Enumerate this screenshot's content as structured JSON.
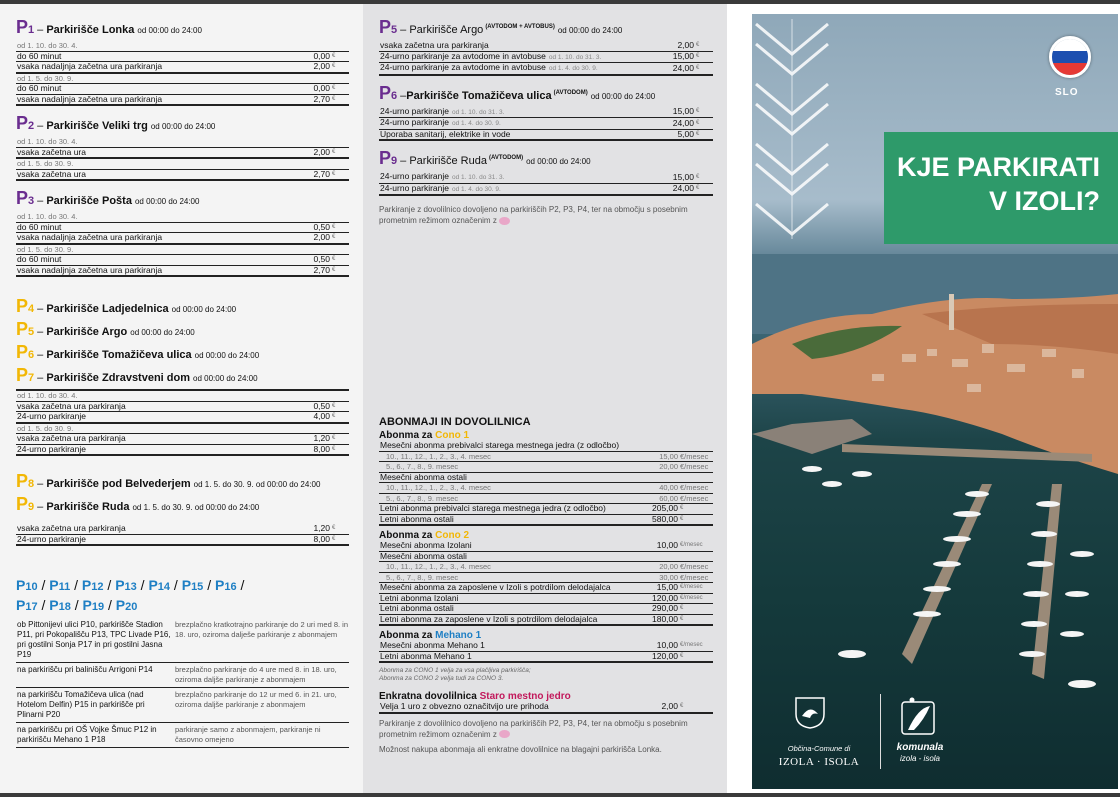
{
  "col1": {
    "p1": {
      "num": "1",
      "name": "Parkirišče Lonka",
      "hours": "od 00:00 do 24:00",
      "rows": [
        {
          "label": "od 1. 10. do 30. 4.",
          "value": "",
          "unit": "",
          "kind": "sec"
        },
        {
          "label": "do 60 minut",
          "value": "0,00",
          "unit": "€",
          "kind": "line"
        },
        {
          "label": "vsaka nadaljnja začetna ura parkiranja",
          "value": "2,00",
          "unit": "€",
          "kind": "bold"
        },
        {
          "label": "od 1. 5. do 30. 9.",
          "value": "",
          "unit": "",
          "kind": "sec"
        },
        {
          "label": "do 60 minut",
          "value": "0,00",
          "unit": "€",
          "kind": "line"
        },
        {
          "label": "vsaka nadaljnja začetna ura parkiranja",
          "value": "2,70",
          "unit": "€",
          "kind": "bold"
        }
      ]
    },
    "p2": {
      "num": "2",
      "name": "Parkirišče Veliki trg",
      "hours": "od 00:00 do 24:00",
      "rows": [
        {
          "label": "od 1. 10. do 30. 4.",
          "value": "",
          "unit": "",
          "kind": "sec"
        },
        {
          "label": "vsaka začetna ura",
          "value": "2,00",
          "unit": "€",
          "kind": "bold"
        },
        {
          "label": "od 1. 5. do 30. 9.",
          "value": "",
          "unit": "",
          "kind": "sec"
        },
        {
          "label": "vsaka začetna ura",
          "value": "2,70",
          "unit": "€",
          "kind": "bold"
        }
      ]
    },
    "p3": {
      "num": "3",
      "name": "Parkirišče Pošta",
      "hours": "od 00:00 do 24:00",
      "rows": [
        {
          "label": "od 1. 10. do 30. 4.",
          "value": "",
          "unit": "",
          "kind": "sec"
        },
        {
          "label": "do 60 minut",
          "value": "0,50",
          "unit": "€",
          "kind": "line"
        },
        {
          "label": "vsaka nadaljnja začetna ura parkiranja",
          "value": "2,00",
          "unit": "€",
          "kind": "bold"
        },
        {
          "label": "od 1. 5. do 30. 9.",
          "value": "",
          "unit": "",
          "kind": "sec"
        },
        {
          "label": "do 60 minut",
          "value": "0,50",
          "unit": "€",
          "kind": "line"
        },
        {
          "label": "vsaka nadaljnja začetna ura parkiranja",
          "value": "2,70",
          "unit": "€",
          "kind": "bold"
        }
      ]
    },
    "p4": {
      "num": "4",
      "name": "Parkirišče Ladjedelnica",
      "hours": "od 00:00 do 24:00"
    },
    "p5": {
      "num": "5",
      "name": "Parkirišče Argo",
      "hours": "od 00:00 do 24:00"
    },
    "p6": {
      "num": "6",
      "name": "Parkirišče Tomažičeva ulica",
      "hours": "od 00:00 do 24:00"
    },
    "p7": {
      "num": "7",
      "name": "Parkirišče Zdravstveni dom",
      "hours": "od 00:00 do 24:00"
    },
    "p4to7_rows": [
      {
        "label": "od 1. 10. do 30. 4.",
        "value": "",
        "unit": "",
        "kind": "sec"
      },
      {
        "label": "vsaka začetna ura parkiranja",
        "value": "0,50",
        "unit": "€",
        "kind": "line"
      },
      {
        "label": "24-urno parkiranje",
        "value": "4,00",
        "unit": "€",
        "kind": "bold"
      },
      {
        "label": "od 1. 5. do 30. 9.",
        "value": "",
        "unit": "",
        "kind": "sec"
      },
      {
        "label": "vsaka začetna ura parkiranja",
        "value": "1,20",
        "unit": "€",
        "kind": "line"
      },
      {
        "label": "24-urno parkiranje",
        "value": "8,00",
        "unit": "€",
        "kind": "bold"
      }
    ],
    "p8": {
      "num": "8",
      "name": "Parkirišče pod Belvederjem",
      "hours": "od 1. 5. do 30. 9. od 00:00 do 24:00"
    },
    "p9": {
      "num": "9",
      "name": "Parkirišče Ruda",
      "hours": "od 1. 5. do 30. 9. od 00:00 do 24:00"
    },
    "p8to9_rows": [
      {
        "label": "vsaka začetna ura parkiranja",
        "value": "1,20",
        "unit": "€",
        "kind": "line"
      },
      {
        "label": "24-urno parkiranje",
        "value": "8,00",
        "unit": "€",
        "kind": "bold"
      }
    ],
    "free_heading_line1": [
      "10",
      "11",
      "12",
      "13",
      "14",
      "15",
      "16"
    ],
    "free_heading_line2": [
      "17",
      "18",
      "19",
      "20"
    ],
    "free_rows": [
      {
        "left": "ob Pittonijevi ulici P10, parkirišče Stadion P11, pri Pokopališču P13, TPC Livade P16, pri gostilni Sonja P17 in pri gostilni Jasna P19",
        "right": "brezplačno kratkotrajno parkiranje do 2 uri med 8. in 18. uro, oziroma dalješe parkiranje z abonmajem"
      },
      {
        "left": "na parkirišču pri balinišču Arrigoni P14",
        "right": "brezplačno parkiranje do 4 ure med 8. in 18. uro, oziroma daljše parkiranje z abonmajem"
      },
      {
        "left": "na parkirišču Tomažičeva ulica (nad Hotelom Delfin) P15 in parkirišče pri Plinarni P20",
        "right": "brezplačno parkiranje do 12 ur med 6. in 21. uro, oziroma daljše parkiranje z abonmajem"
      },
      {
        "left": "na parkirišču pri OŠ Vojke Šmuc P12 in parkirišču Mehano 1 P18",
        "right": "parkiranje samo z abonmajem, parkiranje ni časovno omejeno"
      }
    ]
  },
  "col2": {
    "p5": {
      "num": "5",
      "name": "Parkirišče Argo",
      "tag": "(AVTODOM + AVTOBUS)",
      "hours": "od 00:00 do 24:00",
      "rows": [
        {
          "label": "vsaka začetna ura parkiranja",
          "sub": "",
          "value": "2,00",
          "unit": "€",
          "kind": "line"
        },
        {
          "label": "24-urno parkiranje za avtodome in avtobuse",
          "sub": "od 1. 10. do 31. 3.",
          "value": "15,00",
          "unit": "€",
          "kind": "line"
        },
        {
          "label": "24-urno parkiranje za avtodome in avtobuse",
          "sub": "od 1. 4. do 30. 9.",
          "value": "24,00",
          "unit": "€",
          "kind": "bold"
        }
      ]
    },
    "p6": {
      "num": "6",
      "name": "Parkirišče Tomažičeva ulica",
      "tag": "(AVTODOM)",
      "hours": "od 00:00 do 24:00",
      "rows": [
        {
          "label": "24-urno parkiranje",
          "sub": "od 1. 10. do 31. 3.",
          "value": "15,00",
          "unit": "€",
          "kind": "line"
        },
        {
          "label": "24-urno parkiranje",
          "sub": "od 1. 4. do 30. 9.",
          "value": "24,00",
          "unit": "€",
          "kind": "line"
        },
        {
          "label": "Uporaba sanitarij, elektrike in vode",
          "sub": "",
          "value": "5,00",
          "unit": "€",
          "kind": "bold"
        }
      ]
    },
    "p9": {
      "num": "9",
      "name": "Parkirišče Ruda",
      "tag": "(AVTODOM)",
      "hours": "od 00:00 do 24:00",
      "rows": [
        {
          "label": "24-urno parkiranje",
          "sub": "od 1. 10. do 31. 3.",
          "value": "15,00",
          "unit": "€",
          "kind": "line"
        },
        {
          "label": "24-urno parkiranje",
          "sub": "od 1. 4. do 30. 9.",
          "value": "24,00",
          "unit": "€",
          "kind": "bold"
        }
      ]
    },
    "note1": "Parkiranje z dovolilnico dovoljeno na parkiriščih P2, P3, P4, ter na območju s posebnim prometnim režimom označenim z",
    "abon_title": "ABONMAJI IN DOVOLILNICA",
    "cono1_prefix": "Abonma za",
    "cono1_name": "Cono 1",
    "cono1_rows": [
      {
        "label": "Mesečni abonma prebivalci starega mestnega jedra (z odločbo)",
        "value": "",
        "unit": "",
        "kind": "line"
      },
      {
        "label": "10., 11., 12., 1., 2., 3., 4. mesec",
        "value": "15,00",
        "unit": "€/mesec",
        "kind": "sub"
      },
      {
        "label": "5., 6., 7., 8., 9. mesec",
        "value": "20,00",
        "unit": "€/mesec",
        "kind": "sub"
      },
      {
        "label": "Mesečni abonma ostali",
        "value": "",
        "unit": "",
        "kind": "line"
      },
      {
        "label": "10., 11., 12., 1., 2., 3., 4. mesec",
        "value": "40,00",
        "unit": "€/mesec",
        "kind": "sub"
      },
      {
        "label": "5., 6., 7., 8., 9. mesec",
        "value": "60,00",
        "unit": "€/mesec",
        "kind": "sub"
      },
      {
        "label": "Letni abonma prebivalci starega mestnega jedra (z odločbo)",
        "value": "205,00",
        "unit": "€",
        "kind": "line"
      },
      {
        "label": "Letni abonma ostali",
        "value": "580,00",
        "unit": "€",
        "kind": "bold"
      }
    ],
    "cono2_prefix": "Abonma za",
    "cono2_name": "Cono 2",
    "cono2_rows": [
      {
        "label": "Mesečni abonma Izolani",
        "value": "10,00",
        "unit": "€/mesec",
        "kind": "line"
      },
      {
        "label": "Mesečni abonma ostali",
        "value": "",
        "unit": "",
        "kind": "line"
      },
      {
        "label": "10., 11., 12., 1., 2., 3., 4. mesec",
        "value": "20,00",
        "unit": "€/mesec",
        "kind": "sub"
      },
      {
        "label": "5., 6., 7., 8., 9. mesec",
        "value": "30,00",
        "unit": "€/mesec",
        "kind": "sub"
      },
      {
        "label": "Mesečni abonma za zaposlene v Izoli s potrdilom delodajalca",
        "value": "15,00",
        "unit": "€/mesec",
        "kind": "line"
      },
      {
        "label": "Letni abonma Izolani",
        "value": "120,00",
        "unit": "€/mesec",
        "kind": "line"
      },
      {
        "label": "Letni abonma ostali",
        "value": "290,00",
        "unit": "€",
        "kind": "line"
      },
      {
        "label": "Letni abonma za zaposlene v Izoli s potrdilom delodajalca",
        "value": "180,00",
        "unit": "€",
        "kind": "bold"
      }
    ],
    "mehano_prefix": "Abonma za",
    "mehano_name": "Mehano 1",
    "mehano_rows": [
      {
        "label": "Mesečni abonma Mehano 1",
        "value": "10,00",
        "unit": "€/mesec",
        "kind": "line"
      },
      {
        "label": "Letni abonma Mehano 1",
        "value": "120,00",
        "unit": "€",
        "kind": "bold"
      }
    ],
    "italic1": "Abonma za CONO 1 velja za vsa plačljiva parkirišča;",
    "italic2": "Abonma za CONO 2 velja tudi za CONO 3.",
    "enkratna_prefix": "Enkratna dovolilnica",
    "enkratna_name": "Staro mestno jedro",
    "enkratna_rows": [
      {
        "label": "Velja 1 uro z obvezno označitvijo ure prihoda",
        "value": "2,00",
        "unit": "€",
        "kind": "bold"
      }
    ],
    "note2": "Parkiranje z dovolilnico dovoljeno na parkiriščih P2, P3, P4, ter na območju s posebnim prometnim režimom označenim z",
    "note3": "Možnost nakupa abonmaja ali enkratne dovolilnice na blagajni parkirišča Lonka."
  },
  "cover": {
    "lang": "SLO",
    "title_line1": "KJE PARKIRATI",
    "title_line2": "V IZOLI?",
    "municipality_line1": "Občina-Comune di",
    "municipality_line2": "IZOLA · ISOLA",
    "komunala_line1": "komunala",
    "komunala_line2": "izola - isola"
  },
  "colors": {
    "purple": "#6a2d8f",
    "yellow": "#f2b705",
    "blue": "#1e7fc4",
    "green": "#2e9a6a",
    "red": "#c2185b"
  }
}
